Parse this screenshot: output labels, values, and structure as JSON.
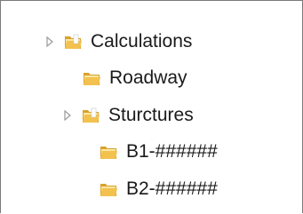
{
  "tree": {
    "items": [
      {
        "label": "Calculations",
        "expandable": true,
        "expanded": false,
        "icon": "folder-icon"
      },
      {
        "label": "Roadway",
        "expandable": false,
        "icon": "folder-icon"
      },
      {
        "label": "Sturctures",
        "expandable": true,
        "expanded": false,
        "icon": "folder-icon"
      },
      {
        "label": "B1-######",
        "expandable": false,
        "icon": "folder-icon"
      },
      {
        "label": "B2-######",
        "expandable": false,
        "icon": "folder-icon"
      }
    ]
  },
  "colors": {
    "folder_yellow": "#f2c14e",
    "folder_dark": "#d9a22a",
    "folder_light": "#fbe7a1",
    "expander_gray": "#9a9a9a",
    "frame_border": "#7a7a7a"
  }
}
